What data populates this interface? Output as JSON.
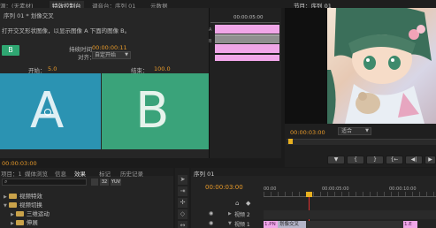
{
  "tabs_top": {
    "t1": "源：(无素材)",
    "t2": "特效控制台",
    "t3": "调音台：序列 01",
    "t4": "元数据",
    "program_tab": "节目：序列 01"
  },
  "effect_controls": {
    "clip_title": "序列 01 * 划像交叉",
    "description": "打开交叉形状图像，以显示图像 A 下面的图像 B。",
    "duration_label": "持续时间",
    "duration_value": "00:00:00:11",
    "align_label": "对齐：",
    "align_value": "自定开始",
    "start_label": "开始：",
    "start_value": "5.0",
    "end_label": "结束：",
    "end_value": "100.0",
    "play_label": "B",
    "preview_a": "A",
    "preview_b": "B",
    "footer_timecode": "00:00:03:00",
    "mini_timecode": "00:00:05:00",
    "mini_track_labels": [
      "A",
      "B"
    ]
  },
  "program_monitor": {
    "timecode": "00:00:03:00",
    "fit_value": "适合",
    "transport_buttons": [
      "▼",
      "{",
      "}",
      "{←",
      "◀|",
      "▶",
      "|▶"
    ]
  },
  "project_panel": {
    "tabs": [
      "项目：1",
      "媒体浏览",
      "信息",
      "效果",
      "标记",
      "历史记录"
    ],
    "tree": [
      {
        "label": "视频特效",
        "indent": 0,
        "expanded": false
      },
      {
        "label": "视频切换",
        "indent": 0,
        "expanded": true
      },
      {
        "label": "三维运动",
        "indent": 1,
        "expanded": false
      },
      {
        "label": "伸展",
        "indent": 1,
        "expanded": false
      }
    ],
    "icon_labels": [
      "32",
      "YUV"
    ]
  },
  "timeline": {
    "tab": "序列 01",
    "timecode": "00:00:03:00",
    "ruler": [
      "00:00",
      "00:00:05:00",
      "00:00:10:00"
    ],
    "tracks": [
      {
        "name": "视频 2"
      },
      {
        "name": "视频 1",
        "clip_a": "1.PN",
        "transition": "划像交叉",
        "clip_b": "1.E"
      }
    ]
  },
  "colors": {
    "panel_bg": "#262626",
    "tab_bg": "#1e1e1e",
    "accent_orange": "#e89a2a",
    "preview_a": "#2b93b2",
    "preview_b": "#3aa37a",
    "transition_pink": "#f0a6e8",
    "playhead": "#e8b020"
  }
}
